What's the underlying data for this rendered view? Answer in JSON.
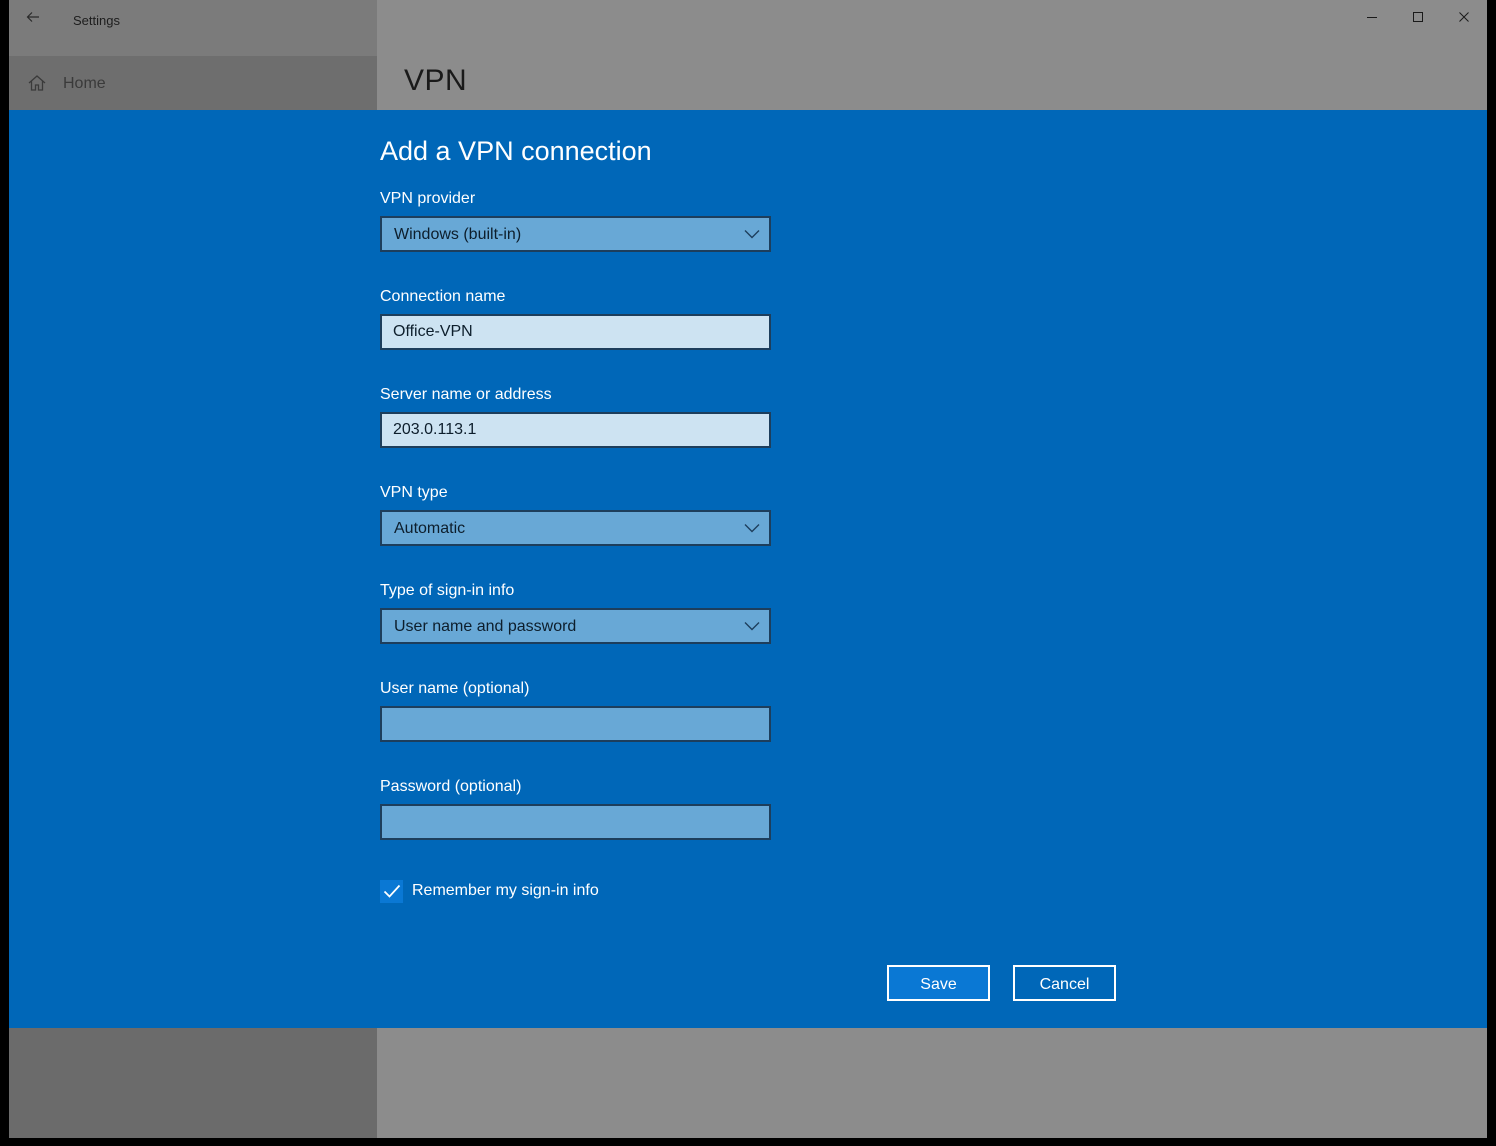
{
  "window": {
    "app_title": "Settings",
    "page_title": "VPN"
  },
  "sidebar": {
    "home_label": "Home"
  },
  "dialog": {
    "title": "Add a VPN connection",
    "vpn_provider": {
      "label": "VPN provider",
      "value": "Windows (built-in)"
    },
    "connection_name": {
      "label": "Connection name",
      "value": "Office-VPN"
    },
    "server": {
      "label": "Server name or address",
      "value": "203.0.113.1"
    },
    "vpn_type": {
      "label": "VPN type",
      "value": "Automatic"
    },
    "signin_type": {
      "label": "Type of sign-in info",
      "value": "User name and password"
    },
    "username": {
      "label": "User name (optional)",
      "value": ""
    },
    "password": {
      "label": "Password (optional)",
      "value": ""
    },
    "remember": {
      "label": "Remember my sign-in info",
      "checked": true
    },
    "save_label": "Save",
    "cancel_label": "Cancel"
  },
  "icons": {
    "back": "back-arrow-icon",
    "home": "home-icon",
    "minimize": "minimize-icon",
    "maximize": "maximize-icon",
    "close": "close-icon",
    "dropdown": "chevron-down-icon",
    "check": "checkmark-icon"
  },
  "colors": {
    "dialog_bg": "#0067b8",
    "accent": "#0a78d4",
    "overlay": "#8c8c8c"
  }
}
